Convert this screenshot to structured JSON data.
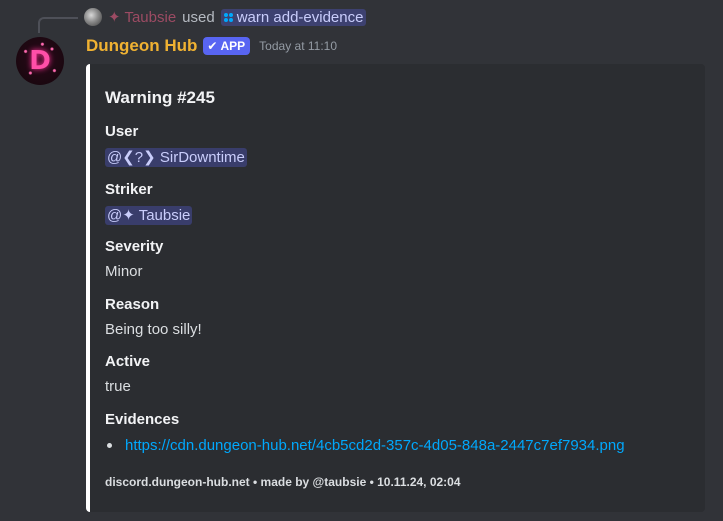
{
  "reply": {
    "user": "✦ Taubsie",
    "used_text": "used",
    "command": "warn add-evidence"
  },
  "message": {
    "author": "Dungeon Hub",
    "badge": "APP",
    "timestamp": "Today at 11:10",
    "avatar_letter": "D"
  },
  "embed": {
    "title": "Warning #245",
    "fields": [
      {
        "name": "User",
        "value": "@❮?❯ SirDowntime"
      },
      {
        "name": "Striker",
        "value": "@✦ Taubsie"
      },
      {
        "name": "Severity",
        "value": "Minor"
      },
      {
        "name": "Reason",
        "value": "Being too silly!"
      },
      {
        "name": "Active",
        "value": "true"
      },
      {
        "name": "Evidences",
        "value": "https://cdn.dungeon-hub.net/4cb5cd2d-357c-4d05-848a-2447c7ef7934.png"
      }
    ],
    "footer": "discord.dungeon-hub.net • made by @taubsie • 10.11.24, 02:04"
  },
  "colors": {
    "background": "#313338",
    "embed_background": "#2b2d31",
    "embed_border": "#ffffff",
    "author_color": "#f0b232",
    "badge_color": "#5865f2",
    "link_color": "#00a8fc",
    "mention_color": "#c9cdfb"
  },
  "icons": {
    "badge_icon": "checkmark-icon",
    "command_icon": "slash-command-icon",
    "list_bullet": "bullet-icon"
  }
}
